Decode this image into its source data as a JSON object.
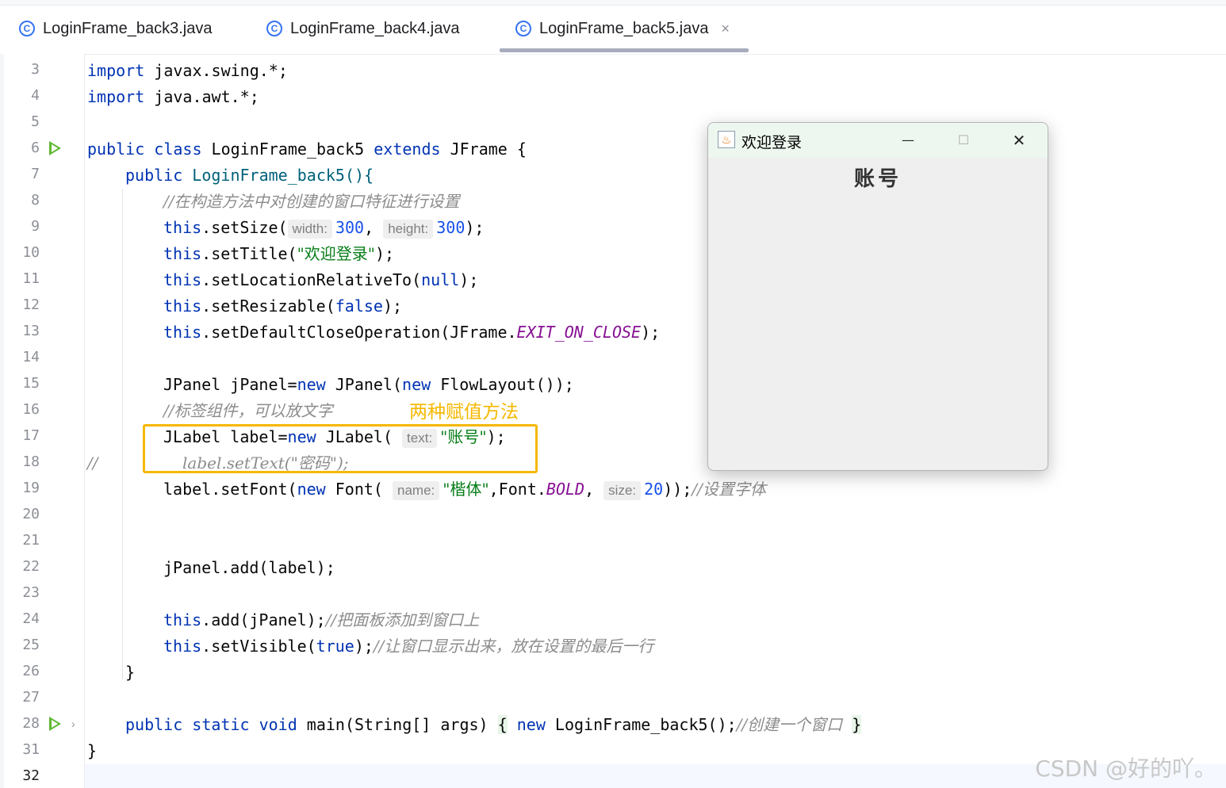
{
  "tabs": [
    {
      "label": "LoginFrame_back3.java",
      "icon": "class-c-icon"
    },
    {
      "label": "LoginFrame_back4.java",
      "icon": "class-c-icon"
    },
    {
      "label": "LoginFrame_back5.java",
      "icon": "class-c-icon",
      "active": true,
      "close": "×"
    }
  ],
  "line_numbers": [
    "3",
    "4",
    "5",
    "6",
    "7",
    "8",
    "9",
    "10",
    "11",
    "12",
    "13",
    "14",
    "15",
    "16",
    "17",
    "18",
    "19",
    "20",
    "21",
    "22",
    "23",
    "24",
    "25",
    "26",
    "27",
    "28",
    "31",
    "32"
  ],
  "code": {
    "l3": [
      "import",
      " javax.swing.*;"
    ],
    "l4": [
      "import",
      " java.awt.*;"
    ],
    "l6": [
      "public",
      " ",
      "class",
      " LoginFrame_back5 ",
      "extends",
      " JFrame {"
    ],
    "l7": [
      "public",
      " LoginFrame_back5(){"
    ],
    "l8": "//在构造方法中对创建的窗口特征进行设置",
    "l9": {
      "a": "this",
      "b": ".setSize(",
      "hint1": "width:",
      "v1": "300",
      "c": ", ",
      "hint2": "height:",
      "v2": "300",
      "d": ");"
    },
    "l10": {
      "a": "this",
      "b": ".setTitle(",
      "s": "\"欢迎登录\"",
      "c": ");"
    },
    "l11": {
      "a": "this",
      "b": ".setLocationRelativeTo(",
      "k": "null",
      "c": ");"
    },
    "l12": {
      "a": "this",
      "b": ".setResizable(",
      "k": "false",
      "c": ");"
    },
    "l13": {
      "a": "this",
      "b": ".setDefaultCloseOperation(JFrame.",
      "cst": "EXIT_ON_CLOSE",
      "c": ");"
    },
    "l15": {
      "a": "JPanel jPanel=",
      "k1": "new",
      "b": " JPanel(",
      "k2": "new",
      "c": " FlowLayout());"
    },
    "l16": "//标签组件，可以放文字",
    "l17": {
      "a": "JLabel label=",
      "k": "new",
      "b": " JLabel( ",
      "hint": "text:",
      "s": "\"账号\"",
      "c": ");"
    },
    "l18": {
      "slash": "//",
      "a": "label.setText(\"密码\");"
    },
    "l19": {
      "a": "label.setFont(",
      "k": "new",
      "b": " Font( ",
      "hint1": "name:",
      "s": "\"楷体\"",
      "c": ",Font.",
      "cst": "BOLD",
      "d": ", ",
      "hint2": "size:",
      "v": "20",
      "e": "));",
      "cmt": "//设置字体"
    },
    "l22": "jPanel.add(label);",
    "l24": {
      "a": "this",
      "b": ".add(jPanel);",
      "cmt": "//把面板添加到窗口上"
    },
    "l25": {
      "a": "this",
      "b": ".setVisible(",
      "k": "true",
      "c": ");",
      "cmt": "//让窗口显示出来，放在设置的最后一行"
    },
    "l26": "}",
    "l28": {
      "k1": "public",
      "k2": "static",
      "k3": "void",
      "a": " main(String[] args) ",
      "ob": "{",
      "k4": "new",
      "b": " LoginFrame_back5();",
      "cmt": "//创建一个窗口",
      "cb": "}"
    },
    "l31": "}"
  },
  "annotation": "两种赋值方法",
  "swing_window": {
    "title": "欢迎登录",
    "label": "账号",
    "minimize": "—",
    "maximize": "☐",
    "close": "✕"
  },
  "watermark": "CSDN @好的吖。"
}
